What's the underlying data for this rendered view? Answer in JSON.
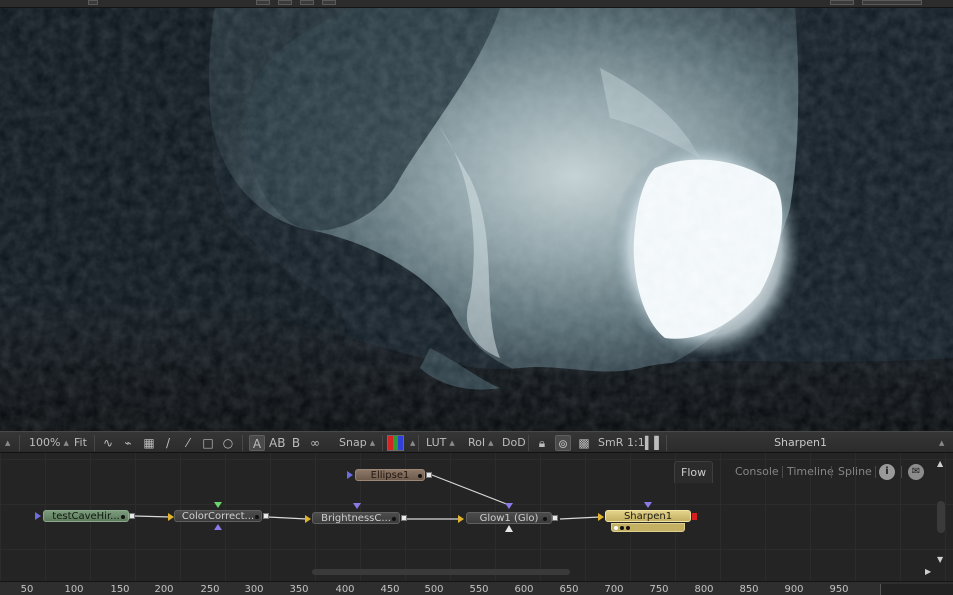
{
  "viewer_toolbar": {
    "zoom": "100%",
    "fit_label": "Fit",
    "snap_label": "Snap",
    "lut_label": "LUT",
    "roi_label": "RoI",
    "dod_label": "DoD",
    "smr_label": "SmR",
    "one_to_one": "1:1",
    "a_label": "A",
    "ab_label": "AB",
    "b_label": "B",
    "viewer_title": "Sharpen1"
  },
  "flow_tabs": {
    "flow": "Flow",
    "console": "Console",
    "timeline": "Timeline",
    "spline": "Spline",
    "info_icon": "i"
  },
  "nodes": {
    "loader": "testCaveHir...",
    "color_correct": "ColorCorrect...",
    "brightness": "BrightnessC...",
    "glow": "Glow1  (Glo)",
    "sharpen": "Sharpen1",
    "ellipse": "Ellipse1"
  },
  "ruler": {
    "ticks": [
      "50",
      "100",
      "150",
      "200",
      "250",
      "300",
      "350",
      "400",
      "450",
      "500",
      "550",
      "600",
      "650",
      "700",
      "750",
      "800",
      "850",
      "900",
      "950"
    ]
  },
  "colors": {
    "active_node": "#e3d28a",
    "loader_node": "#7c9a7c",
    "mask_node": "#8d7868",
    "output_port": "#d42020"
  },
  "icons": [
    "curve-icon",
    "checker-icon",
    "pen-icon",
    "wand-icon",
    "rect-icon",
    "circle-icon",
    "lock-icon",
    "swirl-icon",
    "grid-icon",
    "info-icon",
    "comment-icon"
  ]
}
